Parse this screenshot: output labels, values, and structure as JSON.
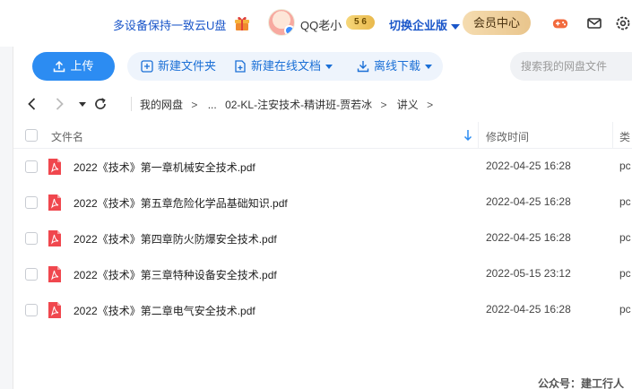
{
  "header": {
    "promo_text": "多设备保持一致云U盘",
    "username": "QQ老小",
    "level_badge": "5 6",
    "enterprise_label": "切换企业版",
    "vip_button": "会员中心",
    "icons": [
      "gift-icon",
      "avatar",
      "game-controller-icon",
      "mail-icon",
      "settings-icon"
    ]
  },
  "toolbar": {
    "upload_label": "上传",
    "new_folder_label": "新建文件夹",
    "new_online_doc_label": "新建在线文档",
    "offline_download_label": "离线下载",
    "search_placeholder": "搜索我的网盘文件"
  },
  "breadcrumb": {
    "root": "我的网盘",
    "ellipsis": "...",
    "parent": "02-KL-注安技术-精讲班-贾若冰",
    "current": "讲义",
    "separator": ">"
  },
  "table": {
    "columns": {
      "name": "文件名",
      "modified": "修改时间",
      "type": "类"
    },
    "rows": [
      {
        "name": "2022《技术》第一章机械安全技术.pdf",
        "modified": "2022-04-25 16:28",
        "type": "pc"
      },
      {
        "name": "2022《技术》第五章危险化学品基础知识.pdf",
        "modified": "2022-04-25 16:28",
        "type": "pc"
      },
      {
        "name": "2022《技术》第四章防火防爆安全技术.pdf",
        "modified": "2022-04-25 16:28",
        "type": "pc"
      },
      {
        "name": "2022《技术》第三章特种设备安全技术.pdf",
        "modified": "2022-05-15 23:12",
        "type": "pc"
      },
      {
        "name": "2022《技术》第二章电气安全技术.pdf",
        "modified": "2022-04-25 16:28",
        "type": "pc"
      }
    ]
  },
  "watermark": "公众号：建工行人",
  "colors": {
    "accent": "#2c8cf2",
    "link": "#1a56c9",
    "pdf_red": "#f0474e",
    "vip_gold": "#e9c58c"
  }
}
